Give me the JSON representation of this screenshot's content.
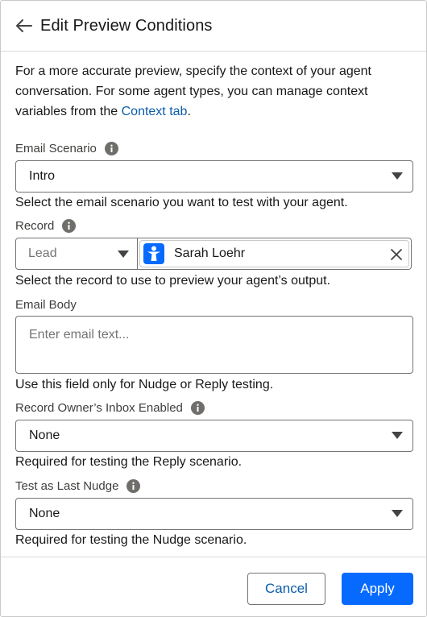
{
  "header": {
    "title": "Edit Preview Conditions"
  },
  "intro": {
    "text_before": "For a more accurate preview, specify the context of your agent conversation. For some agent types, you can manage context variables from the ",
    "link": "Context tab",
    "text_after": "."
  },
  "email_scenario": {
    "label": "Email Scenario",
    "value": "Intro",
    "help": "Select the email scenario you want to test with your agent."
  },
  "record": {
    "label": "Record",
    "object_type": "Lead",
    "selected": "Sarah Loehr",
    "help": "Select the record to use to preview your agent’s output."
  },
  "email_body": {
    "label": "Email Body",
    "placeholder": "Enter email text...",
    "help": "Use this field only for Nudge or Reply testing."
  },
  "inbox_enabled": {
    "label": "Record Owner’s Inbox Enabled",
    "value": "None",
    "help": "Required for testing the Reply scenario."
  },
  "last_nudge": {
    "label": "Test as Last Nudge",
    "value": "None",
    "help": "Required for testing the Nudge scenario."
  },
  "footer": {
    "cancel_label": "Cancel",
    "apply_label": "Apply"
  },
  "colors": {
    "brand": "#066afe",
    "link": "#0b5cab",
    "text": "#181818",
    "border": "#747474"
  },
  "icons": {
    "back": "arrow-left-icon",
    "info": "info-icon",
    "lead": "lead-person-icon",
    "remove": "close-icon",
    "dropdown": "caret-down-icon"
  }
}
